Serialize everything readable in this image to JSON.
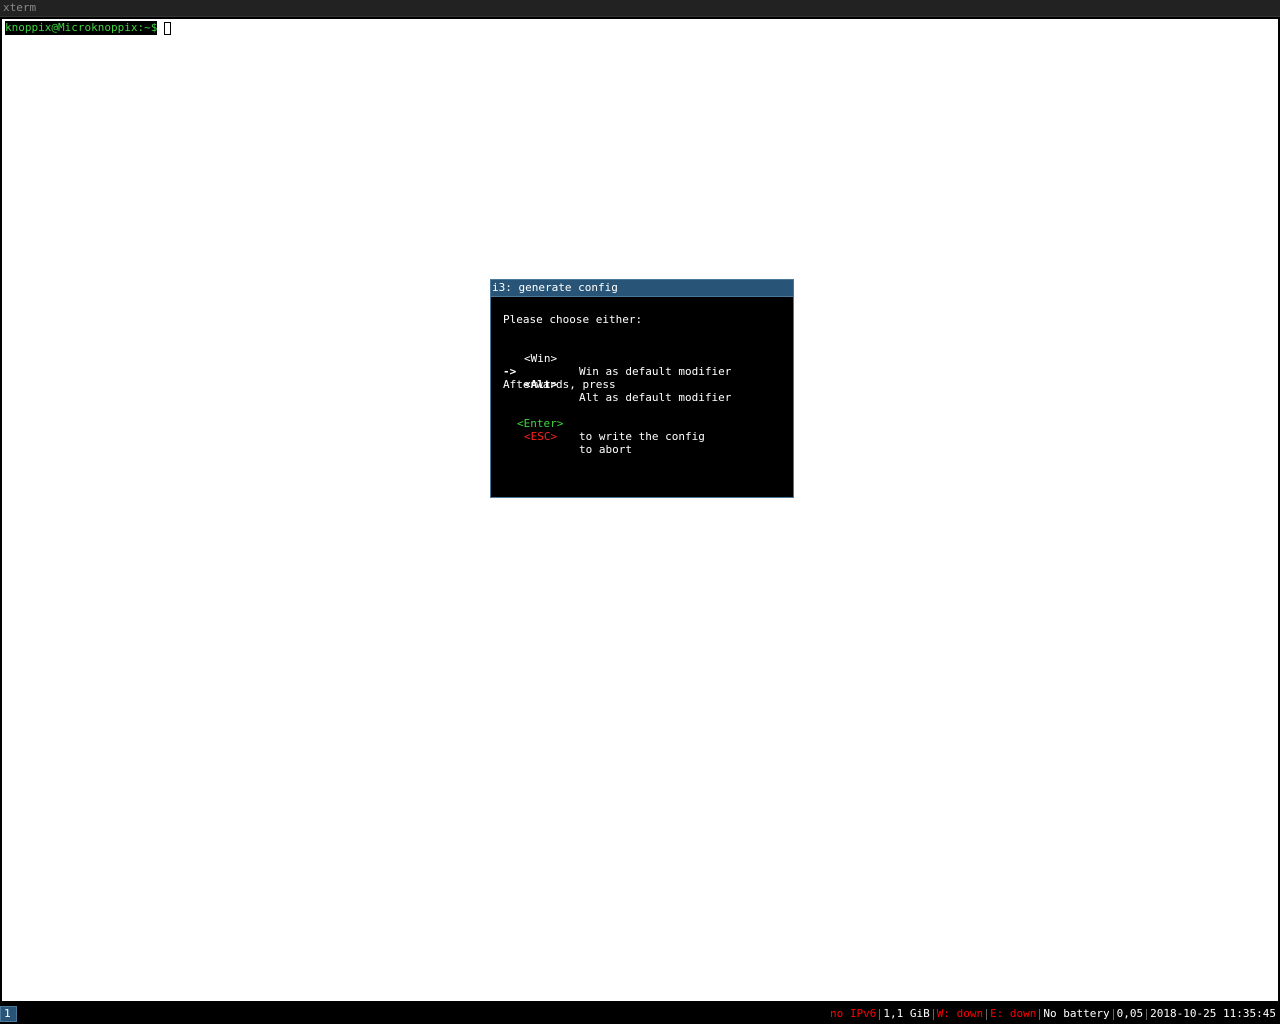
{
  "xterm": {
    "window_title": "xterm",
    "prompt": "knoppix@Microknoppix:~$"
  },
  "wizard": {
    "title": "i3: generate config",
    "intro": "Please choose either:",
    "option_win": {
      "key": "<Win>",
      "desc": "Win as default modifier"
    },
    "option_alt": {
      "arrow": "->",
      "key": "<Alt>",
      "desc": "Alt as default modifier"
    },
    "afterwards": "Afterwards, press",
    "enter": {
      "key": "<Enter>",
      "desc": "to write the config"
    },
    "esc": {
      "key": "<ESC>",
      "desc": "to abort"
    }
  },
  "i3bar": {
    "workspace": "1",
    "status": {
      "ipv6": "no IPv6",
      "memory": "1,1 GiB",
      "wireless": "W: down",
      "ethernet": "E: down",
      "battery": "No battery",
      "load": "0,05",
      "datetime": "2018-10-25 11:35:45"
    }
  },
  "colors": {
    "focused_title_bg": "#285577",
    "focused_border": "#4c7899",
    "unfocused_title_bg": "#222222",
    "prompt_green": "#3fd43f",
    "status_red": "#ff0000"
  }
}
